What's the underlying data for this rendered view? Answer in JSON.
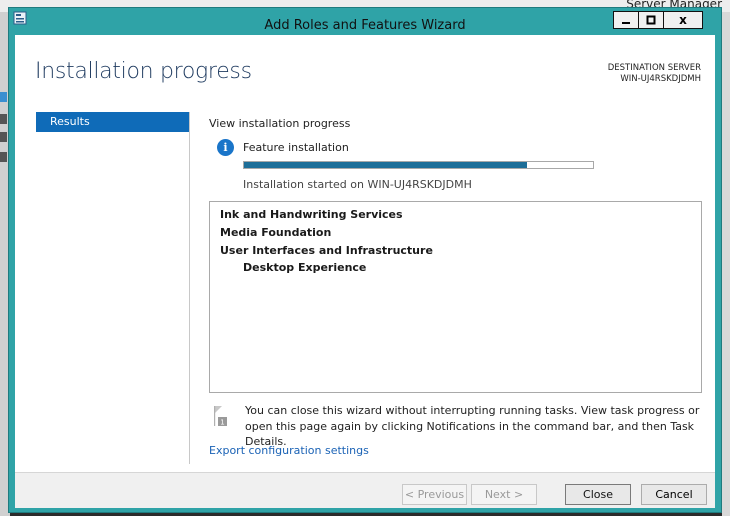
{
  "background": {
    "app_title": "Server Manager"
  },
  "window": {
    "title": "Add Roles and Features Wizard",
    "controls": {
      "minimize_glyph": "▁",
      "maximize_glyph": "□",
      "close_glyph": "x"
    }
  },
  "page": {
    "title": "Installation progress",
    "destination_label": "DESTINATION SERVER",
    "destination_server": "WIN-UJ4RSKDJDMH"
  },
  "nav": {
    "items": [
      {
        "label": "Results",
        "selected": true
      }
    ]
  },
  "content": {
    "section_title": "View installation progress",
    "status_icon": "info-icon",
    "feature_label": "Feature installation",
    "progress": 0.81,
    "progress_color": "#1d6e98",
    "started_text": "Installation started on WIN-UJ4RSKDJDMH",
    "results": [
      {
        "label": "Ink and Handwriting Services",
        "level": 0
      },
      {
        "label": "Media Foundation",
        "level": 0
      },
      {
        "label": "User Interfaces and Infrastructure",
        "level": 0
      },
      {
        "label": "Desktop Experience",
        "level": 1
      }
    ],
    "note_icon": "notification-flag-icon",
    "note": "You can close this wizard without interrupting running tasks. View task progress or open this page again by clicking Notifications in the command bar, and then Task Details.",
    "export_link": "Export configuration settings"
  },
  "footer": {
    "previous": "< Previous",
    "next": "Next >",
    "close": "Close",
    "cancel": "Cancel"
  },
  "colors": {
    "window_frame": "#2fa3a7",
    "nav_selected": "#0f6bb8",
    "link": "#1a62b5"
  }
}
